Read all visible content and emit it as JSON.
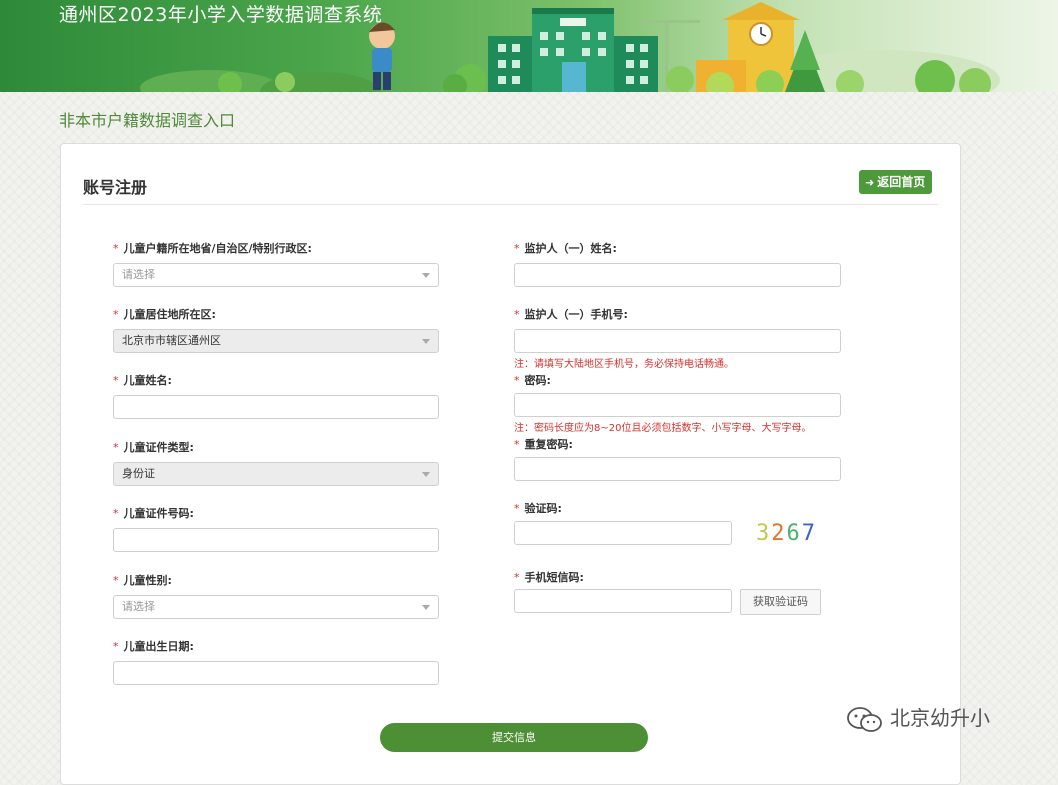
{
  "header": {
    "title": "通州区2023年小学入学数据调查系统"
  },
  "section_title": "非本市户籍数据调查入口",
  "card": {
    "title": "账号注册",
    "back_button": "返回首页"
  },
  "left_fields": [
    {
      "label": "儿童户籍所在地省/自治区/特别行政区:",
      "value": "请选择",
      "type": "select"
    },
    {
      "label": "儿童居住地所在区:",
      "value": "北京市市辖区通州区",
      "type": "disabled-select"
    },
    {
      "label": "儿童姓名:",
      "value": "",
      "type": "text"
    },
    {
      "label": "儿童证件类型:",
      "value": "身份证",
      "type": "disabled-select"
    },
    {
      "label": "儿童证件号码:",
      "value": "",
      "type": "text"
    },
    {
      "label": "儿童性别:",
      "value": "请选择",
      "type": "select"
    },
    {
      "label": "儿童出生日期:",
      "value": "",
      "type": "text"
    }
  ],
  "right_fields": {
    "guardian_name": {
      "label": "监护人（一）姓名:",
      "value": ""
    },
    "guardian_phone": {
      "label": "监护人（一）手机号:",
      "value": "",
      "note": "注：请填写大陆地区手机号，务必保持电话畅通。"
    },
    "password": {
      "label": "密码:",
      "value": "",
      "note": "注：密码长度应为8~20位且必须包括数字、小写字母、大写字母。"
    },
    "password_confirm": {
      "label": "重复密码:",
      "value": ""
    },
    "captcha": {
      "label": "验证码:",
      "value": "",
      "code": [
        "3",
        "2",
        "6",
        "7"
      ],
      "colors": [
        "#c3c94a",
        "#e0762e",
        "#4cb36a",
        "#3a63c8"
      ]
    },
    "sms_code": {
      "label": "手机短信码:",
      "value": "",
      "button": "获取验证码"
    }
  },
  "required_mark": "*",
  "submit_button": "提交信息",
  "watermark": "北京幼升小"
}
